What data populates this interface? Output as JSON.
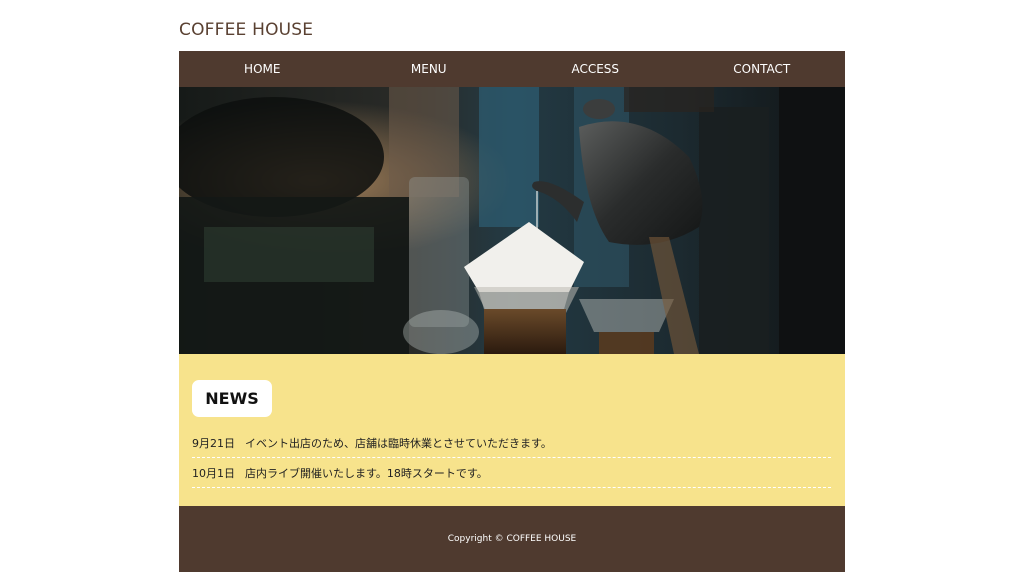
{
  "header": {
    "site_title": "COFFEE HOUSE"
  },
  "nav": {
    "items": [
      {
        "label": "HOME"
      },
      {
        "label": "MENU"
      },
      {
        "label": "ACCESS"
      },
      {
        "label": "CONTACT"
      }
    ]
  },
  "hero": {
    "image_subject": "pour-over coffee being brewed with a kettle"
  },
  "news": {
    "heading": "NEWS",
    "items": [
      {
        "date": "9月21日",
        "text": "イベント出店のため、店舗は臨時休業とさせていただきます。"
      },
      {
        "date": "10月1日",
        "text": "店内ライブ開催いたします。18時スタートです。"
      }
    ]
  },
  "footer": {
    "copyright": "Copyright © COFFEE HOUSE"
  },
  "colors": {
    "brand_brown": "#4f3a2f",
    "title_brown": "#5a4132",
    "news_yellow": "#f7e38c"
  }
}
